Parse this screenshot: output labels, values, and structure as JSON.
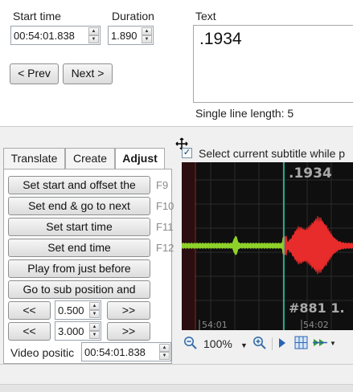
{
  "editor": {
    "start_label": "Start time",
    "start_value": "00:54:01.838",
    "duration_label": "Duration",
    "duration_value": "1.890",
    "text_label": "Text",
    "text_value": ".1934",
    "prev_label": "< Prev",
    "next_label": "Next >",
    "line_length": "Single line length: 5"
  },
  "tabs": [
    "Translate",
    "Create",
    "Adjust"
  ],
  "active_tab": "Adjust",
  "adjust": {
    "buttons": [
      {
        "label": "Set start and offset the",
        "key": "F9"
      },
      {
        "label": "Set end & go to next",
        "key": "F10"
      },
      {
        "label": "Set start time",
        "key": "F11"
      },
      {
        "label": "Set end time",
        "key": "F12"
      },
      {
        "label": "Play from just before",
        "key": ""
      },
      {
        "label": "Go to sub position and",
        "key": ""
      }
    ],
    "step_rows": [
      {
        "back": "<<",
        "value": "0.500",
        "fwd": ">>"
      },
      {
        "back": "<<",
        "value": "3.000",
        "fwd": ">>"
      }
    ],
    "video_pos_label": "Video positic",
    "video_pos_value": "00:54:01.838"
  },
  "waveform": {
    "select_label": "Select current subtitle while p",
    "subtitle_text": ".1934",
    "next_sub_label": "#881 1.",
    "time_labels": [
      "54:01",
      "54:02"
    ],
    "zoom": "100%",
    "colors": {
      "background": "#0f0f0f",
      "wave_active": "#e82b2b",
      "wave_other": "#8ed12a",
      "cursor": "#27d3b0",
      "grid": "#2b2b2b"
    }
  },
  "icons": [
    "spin-up-icon",
    "spin-down-icon",
    "checkbox-checked-icon",
    "zoom-out-icon",
    "dropdown-arrow-icon",
    "zoom-in-icon",
    "play-icon",
    "grid-icon",
    "double-arrow-icon",
    "cursor-move-icon"
  ]
}
